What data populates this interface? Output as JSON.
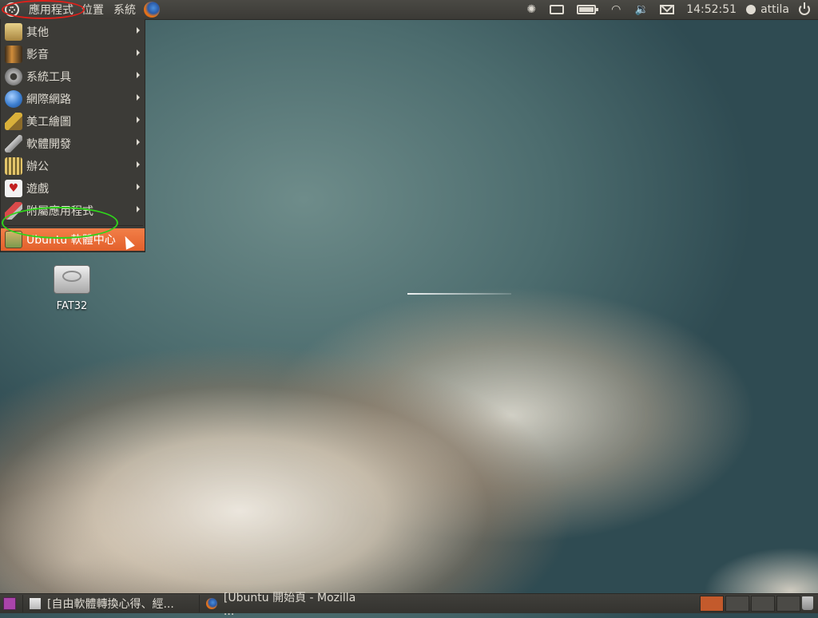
{
  "top_panel": {
    "menus": [
      "應用程式",
      "位置",
      "系統"
    ],
    "clock": "14:52:51",
    "user": "attila",
    "icons": [
      "ubuntu-logo-icon",
      "firefox-icon",
      "network-spiral-icon",
      "keyboard-icon",
      "battery-icon",
      "wifi-icon",
      "volume-icon",
      "mail-icon",
      "user-icon",
      "power-icon"
    ]
  },
  "apps_menu": {
    "items": [
      {
        "label": "其他",
        "icon": "other-icon",
        "color": "#c8a86a",
        "submenu": true
      },
      {
        "label": "影音",
        "icon": "sound-video-icon",
        "color": "#d18d3a",
        "submenu": true
      },
      {
        "label": "系統工具",
        "icon": "system-tools-icon",
        "color": "#9a9a9a",
        "submenu": true
      },
      {
        "label": "網際網路",
        "icon": "internet-icon",
        "color": "#4b8fdc",
        "submenu": true
      },
      {
        "label": "美工繪圖",
        "icon": "graphics-icon",
        "color": "#d9b03a",
        "submenu": true
      },
      {
        "label": "軟體開發",
        "icon": "programming-icon",
        "color": "#b9b9b9",
        "submenu": true
      },
      {
        "label": "辦公",
        "icon": "office-icon",
        "color": "#e2c46a",
        "submenu": true
      },
      {
        "label": "遊戲",
        "icon": "games-icon",
        "color": "#e5e5e5",
        "submenu": true
      },
      {
        "label": "附屬應用程式",
        "icon": "accessories-icon",
        "color": "#d94a4a",
        "submenu": true
      },
      {
        "label": "Ubuntu 軟體中心",
        "icon": "software-center-icon",
        "color": "#7b9a4e",
        "submenu": false,
        "highlighted": true
      }
    ]
  },
  "desktop": {
    "drive_label": "FAT32"
  },
  "bottom_panel": {
    "tasks": [
      {
        "label": "[自由軟體轉換心得、經...",
        "icon": "document-icon"
      },
      {
        "label": "[Ubuntu 開始頁 - Mozilla ...",
        "icon": "firefox-icon"
      }
    ],
    "workspaces": 4,
    "active_workspace": 1
  },
  "colors": {
    "panel": "#3c3b37",
    "highlight": "#f07746",
    "annotation_red": "#e0201a",
    "annotation_green": "#2fd41b"
  }
}
